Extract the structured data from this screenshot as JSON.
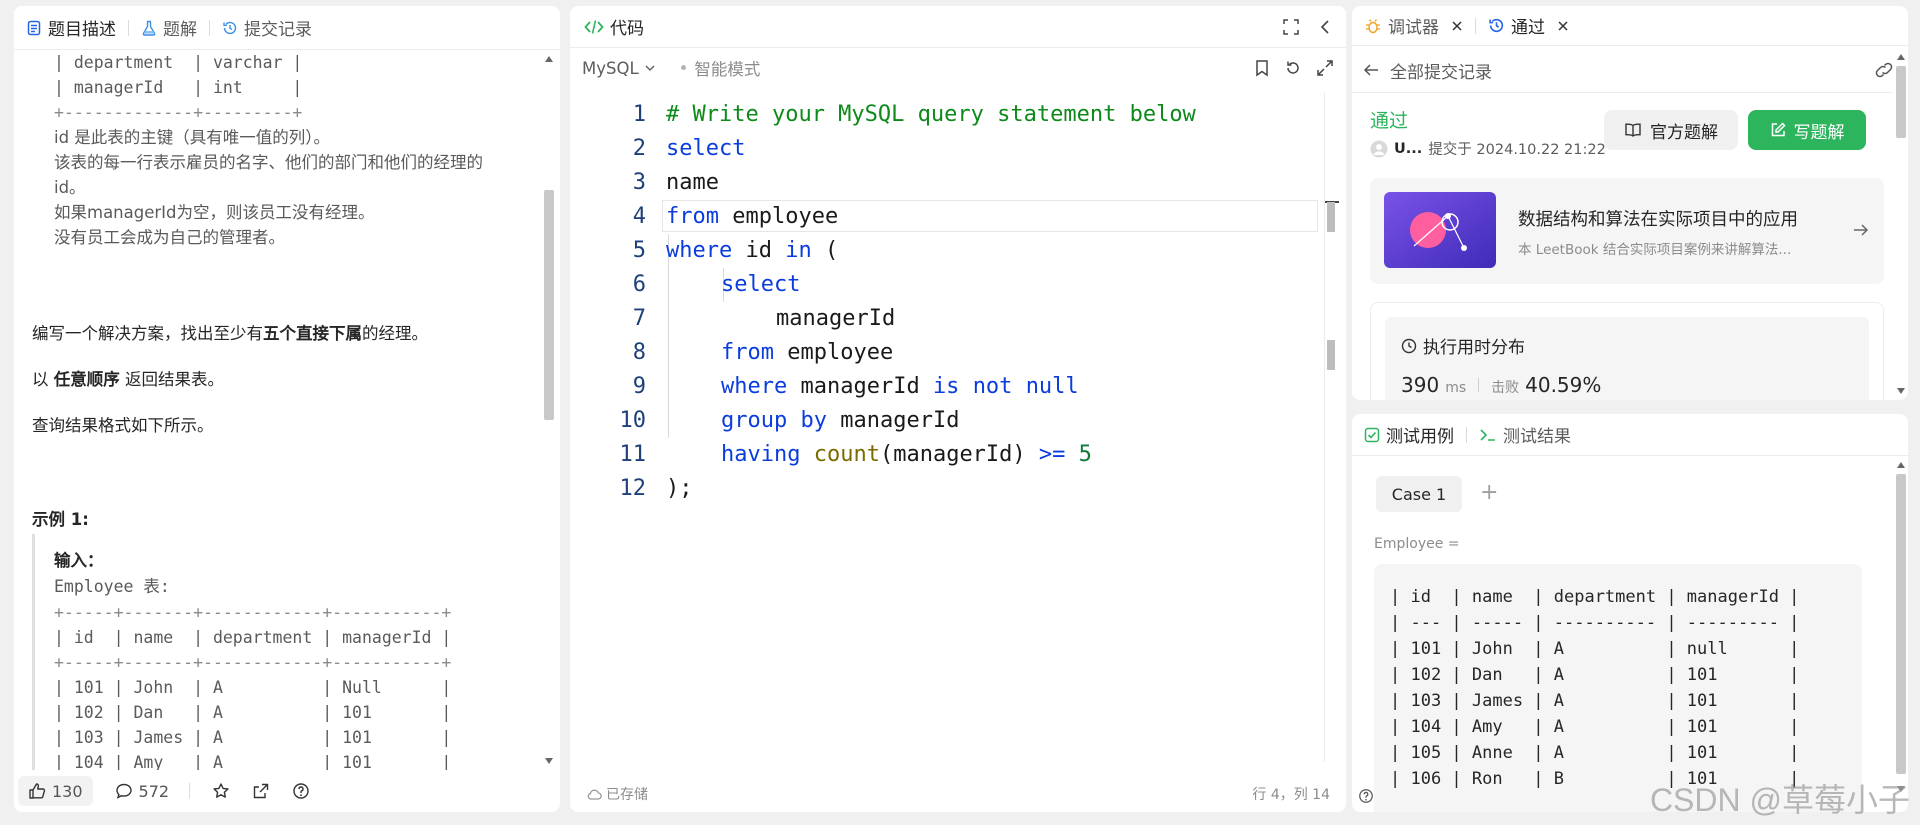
{
  "left": {
    "tabs": [
      "题目描述",
      "题解",
      "提交记录"
    ],
    "pre_lines": [
      "| department  | varchar |",
      "| managerId   | int     |",
      "+-------------+---------+"
    ],
    "desc_lines": [
      "id 是此表的主键（具有唯一值的列）。",
      "该表的每一行表示雇员的名字、他们的部门和他们的经理的",
      "id。",
      "如果managerId为空，则该员工没有经理。",
      "没有员工会成为自己的管理者。"
    ],
    "task_prefix": "编写一个解决方案，找出至少有",
    "task_bold": "五个直接下属",
    "task_suffix": "的经理。",
    "order_prefix": "以 ",
    "order_bold": "任意顺序",
    "order_suffix": " 返回结果表。",
    "format_text": "查询结果格式如下所示。",
    "example_title": "示例 1:",
    "input_label": "输入：",
    "table_name": "Employee 表:",
    "example_lines": [
      "+-----+-------+------------+-----------+",
      "| id  | name  | department | managerId |",
      "+-----+-------+------------+-----------+",
      "| 101 | John  | A          | Null      |",
      "| 102 | Dan   | A          | 101       |",
      "| 103 | James | A          | 101       |",
      "| 104 | Amy   | A          | 101       |"
    ],
    "footer": {
      "likes": "130",
      "comments": "572"
    }
  },
  "code": {
    "title": "代码",
    "language": "MySQL",
    "smart_mode": "智能模式",
    "status_saved": "已存储",
    "cursor_pos": "行 4，列 14",
    "lines": [
      "# Write your MySQL query statement below",
      "select",
      "name",
      "from employee",
      "where id in (",
      "select",
      "managerId",
      "from employee",
      "where managerId is not null",
      "group by managerId",
      "having count(managerId) >= 5",
      ");"
    ]
  },
  "right_top": {
    "tabs": [
      "调试器",
      "通过"
    ],
    "back_label": "全部提交记录",
    "status": "通过",
    "user": "U...",
    "submitted_at": "提交于 2024.10.22 21:22",
    "official_btn": "官方题解",
    "write_btn": "写题解",
    "card_title": "数据结构和算法在实际项目中的应用",
    "card_sub": "本 LeetBook 结合实际项目案例来讲解算法...",
    "perf_title": "执行用时分布",
    "runtime_value": "390",
    "runtime_unit": "ms",
    "beats_label": "击败",
    "beats_value": "40.59%"
  },
  "right_bottom": {
    "tabs": [
      "测试用例",
      "测试结果"
    ],
    "case_label": "Case 1",
    "var_label": "Employee =",
    "table_lines": [
      "| id  | name  | department | managerId |",
      "| --- | ----- | ---------- | --------- |",
      "| 101 | John  | A          | null      |",
      "| 102 | Dan   | A          | 101       |",
      "| 103 | James | A          | 101       |",
      "| 104 | Amy   | A          | 101       |",
      "| 105 | Anne  | A          | 101       |",
      "| 106 | Ron   | B          | 101       |"
    ]
  },
  "watermark": "CSDN @草莓小子",
  "colors": {
    "accent_green": "#2db55d",
    "keyword_blue": "#0b3dde",
    "comment_green": "#0d8a19"
  }
}
